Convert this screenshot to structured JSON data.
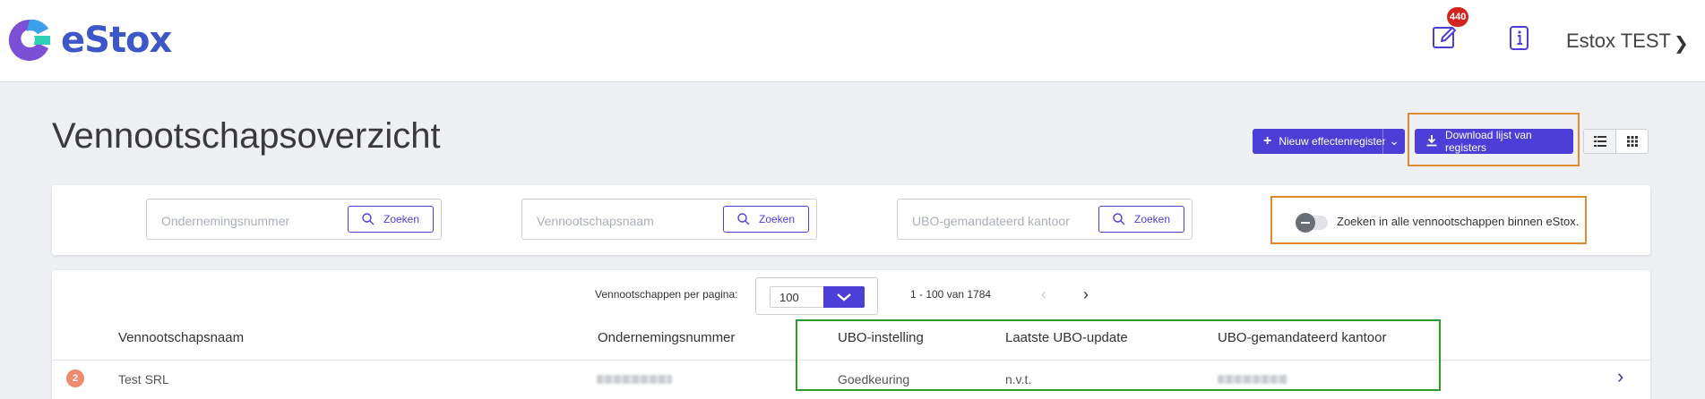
{
  "header": {
    "logo_text": "eStox",
    "notification_count": "440",
    "user_name": "Estox TEST",
    "icons": [
      "edit-icon",
      "info-icon",
      "chevron-right-icon"
    ]
  },
  "page": {
    "title": "Vennootschapsoverzicht",
    "new_register_label": "Nieuw effectenregister",
    "download_label": "Download lijst van registers",
    "view_modes": [
      "list-view-icon",
      "grid-view-icon"
    ]
  },
  "search": {
    "fields": [
      {
        "placeholder": "Ondernemingsnummer",
        "button": "Zoeken"
      },
      {
        "placeholder": "Vennootschapsnaam",
        "button": "Zoeken"
      },
      {
        "placeholder": "UBO-gemandateerd kantoor",
        "button": "Zoeken"
      }
    ],
    "toggle_label": "Zoeken in alle vennootschappen binnen eStox.",
    "toggle_on": false
  },
  "table": {
    "per_page_label": "Vennootschappen per pagina:",
    "per_page_value": "100",
    "range": "1 - 100 van 1784",
    "columns": [
      "Vennootschapsnaam",
      "Ondernemingsnummer",
      "UBO-instelling",
      "Laatste UBO-update",
      "UBO-gemandateerd kantoor"
    ],
    "rows": [
      {
        "badge": "2",
        "name": "Test SRL",
        "number_redacted": true,
        "ubo_setting": "Goedkeuring",
        "last_update": "n.v.t.",
        "office_redacted": true
      }
    ]
  },
  "colors": {
    "primary": "#4b3fd8",
    "brand": "#3d57c8",
    "highlight_orange": "#e08a2e",
    "highlight_green": "#2e9a2e",
    "badge_red": "#d0261f"
  }
}
